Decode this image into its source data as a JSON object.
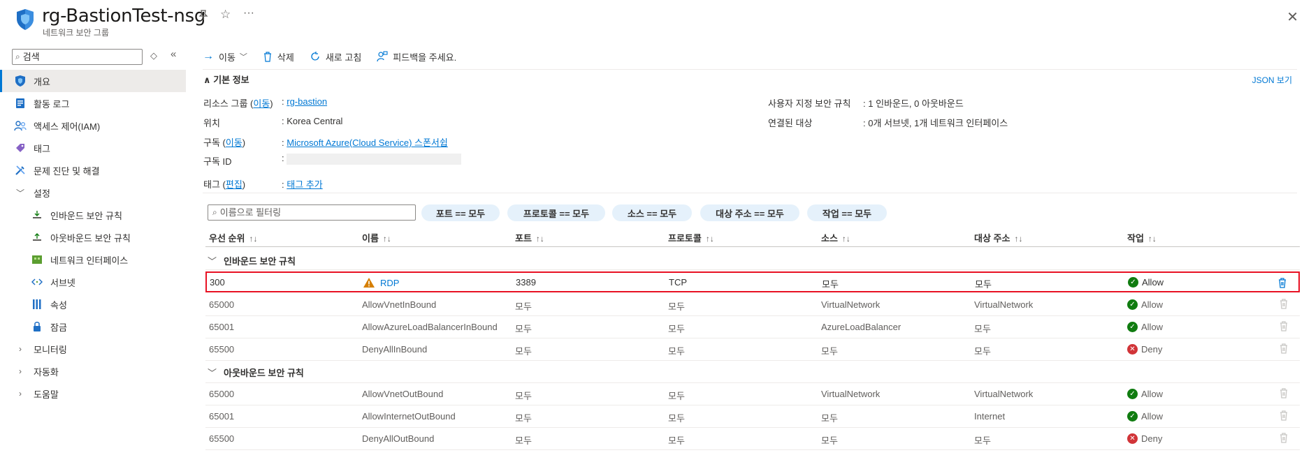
{
  "header": {
    "title": "rg-BastionTest-nsg",
    "subtitle": "네트워크 보안 그룹"
  },
  "sidebar": {
    "search_placeholder": "검색",
    "items": [
      {
        "label": "개요",
        "icon": "shield-icon",
        "level": 0,
        "active": true
      },
      {
        "label": "활동 로그",
        "icon": "log-icon",
        "level": 0
      },
      {
        "label": "액세스 제어(IAM)",
        "icon": "people-icon",
        "level": 0
      },
      {
        "label": "태그",
        "icon": "tag-icon",
        "level": 0
      },
      {
        "label": "문제 진단 및 해결",
        "icon": "wrench-icon",
        "level": 0
      },
      {
        "label": "설정",
        "icon": "chevron-down-icon",
        "level": 0,
        "group": true
      },
      {
        "label": "인바운드 보안 규칙",
        "icon": "inbound-icon",
        "level": 1
      },
      {
        "label": "아웃바운드 보안 규칙",
        "icon": "outbound-icon",
        "level": 1
      },
      {
        "label": "네트워크 인터페이스",
        "icon": "nic-icon",
        "level": 1
      },
      {
        "label": "서브넷",
        "icon": "subnet-icon",
        "level": 1
      },
      {
        "label": "속성",
        "icon": "properties-icon",
        "level": 1
      },
      {
        "label": "잠금",
        "icon": "lock-icon",
        "level": 1
      },
      {
        "label": "모니터링",
        "icon": "chevron-right-icon",
        "level": 0,
        "group": true
      },
      {
        "label": "자동화",
        "icon": "chevron-right-icon",
        "level": 0,
        "group": true
      },
      {
        "label": "도움말",
        "icon": "chevron-right-icon",
        "level": 0,
        "group": true
      }
    ]
  },
  "toolbar": {
    "move": "이동",
    "delete": "삭제",
    "refresh": "새로 고침",
    "feedback": "피드백을 주세요."
  },
  "essentials": {
    "heading": "기본 정보",
    "json_view": "JSON 보기",
    "resource_group_label": "리소스 그룹",
    "move_link": "이동",
    "resource_group_value": "rg-bastion",
    "location_label": "위치",
    "location_value": "Korea Central",
    "subscription_label": "구독",
    "subscription_value": "Microsoft Azure(Cloud Service) 스폰서쉽",
    "subscription_id_label": "구독 ID",
    "tags_label": "태그",
    "edit_link": "편집",
    "tags_value": "태그 추가",
    "custom_rules_label": "사용자 지정 보안 규칙",
    "custom_rules_value": "1 인바운드, 0 아웃바운드",
    "associated_label": "연결된 대상",
    "associated_value": "0개 서브넷, 1개 네트워크 인터페이스"
  },
  "filters": {
    "placeholder": "이름으로 필터링",
    "pills": [
      "포트 == 모두",
      "프로토콜 == 모두",
      "소스 == 모두",
      "대상 주소 == 모두",
      "작업 == 모두"
    ]
  },
  "table": {
    "columns": [
      "우선 순위",
      "이름",
      "포트",
      "프로토콜",
      "소스",
      "대상 주소",
      "작업"
    ],
    "groups": [
      {
        "title": "인바운드 보안 규칙",
        "rows": [
          {
            "priority": "300",
            "name": "RDP",
            "port": "3389",
            "protocol": "TCP",
            "source": "모두",
            "dest": "모두",
            "action": "Allow",
            "warning": true,
            "highlight": true
          },
          {
            "priority": "65000",
            "name": "AllowVnetInBound",
            "port": "모두",
            "protocol": "모두",
            "source": "VirtualNetwork",
            "dest": "VirtualNetwork",
            "action": "Allow"
          },
          {
            "priority": "65001",
            "name": "AllowAzureLoadBalancerInBound",
            "port": "모두",
            "protocol": "모두",
            "source": "AzureLoadBalancer",
            "dest": "모두",
            "action": "Allow"
          },
          {
            "priority": "65500",
            "name": "DenyAllInBound",
            "port": "모두",
            "protocol": "모두",
            "source": "모두",
            "dest": "모두",
            "action": "Deny"
          }
        ]
      },
      {
        "title": "아웃바운드 보안 규칙",
        "rows": [
          {
            "priority": "65000",
            "name": "AllowVnetOutBound",
            "port": "모두",
            "protocol": "모두",
            "source": "VirtualNetwork",
            "dest": "VirtualNetwork",
            "action": "Allow"
          },
          {
            "priority": "65001",
            "name": "AllowInternetOutBound",
            "port": "모두",
            "protocol": "모두",
            "source": "모두",
            "dest": "Internet",
            "action": "Allow"
          },
          {
            "priority": "65500",
            "name": "DenyAllOutBound",
            "port": "모두",
            "protocol": "모두",
            "source": "모두",
            "dest": "모두",
            "action": "Deny"
          }
        ]
      }
    ]
  },
  "colors": {
    "accent": "#0078d4",
    "allow": "#107c10",
    "deny": "#d13438",
    "highlight_border": "#e81123",
    "warning": "#d67f00"
  }
}
